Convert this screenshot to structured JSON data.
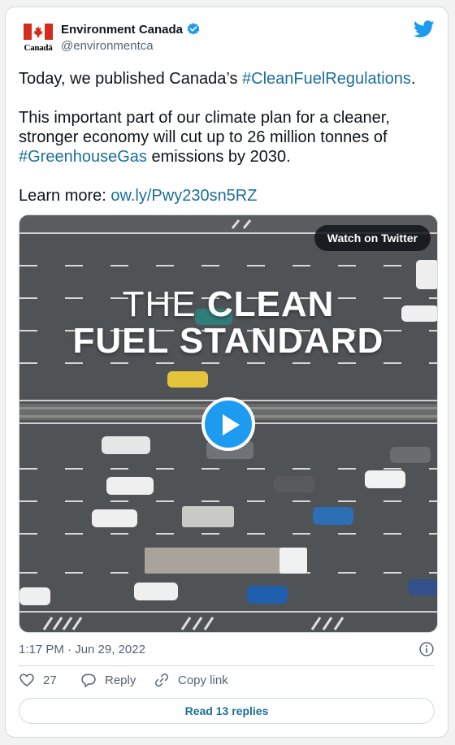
{
  "account": {
    "logo_word": "Canadä",
    "display_name": "Environment Canada",
    "handle": "@environmentca"
  },
  "tweet": {
    "line1_prefix": "Today, we published Canada’s ",
    "hashtag1": "#CleanFuelRegulations",
    "line1_suffix": ".",
    "para2_text": "This important part of our climate plan for a cleaner, stronger economy will cut up to 26 million tonnes of ",
    "hashtag2": "#GreenhouseGas",
    "para2_suffix": " emissions by 2030.",
    "learn_prefix": "Learn more: ",
    "link": "ow.ly/Pwy230sn5RZ"
  },
  "media": {
    "watch_label": "Watch on Twitter",
    "title_the": "THE ",
    "title_clean": "CLEAN",
    "title_line2": "FUEL STANDARD"
  },
  "meta": {
    "timestamp": "1:17 PM · Jun 29, 2022"
  },
  "actions": {
    "like_count": "27",
    "reply_label": "Reply",
    "copy_label": "Copy link"
  },
  "footer": {
    "read_replies": "Read 13 replies"
  },
  "colors": {
    "link": "#1b6f9b",
    "twitter_blue": "#1d9bf0",
    "canada_red": "#d52b1e"
  }
}
